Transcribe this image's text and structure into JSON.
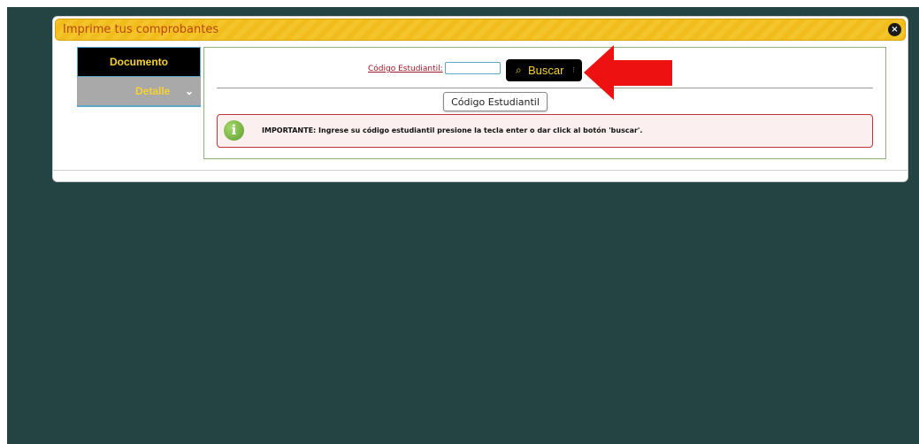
{
  "dialog": {
    "title": "Imprime tus comprobantes",
    "close_icon": "close-icon",
    "close_symbol": "×"
  },
  "sidebar": {
    "items": [
      {
        "label": "Documento",
        "active": true
      },
      {
        "label": "Detalle",
        "active": false,
        "chevron": "⌄"
      }
    ]
  },
  "search": {
    "label": "Código Estudiantil:",
    "input_value": "",
    "button_icon": "⌕",
    "button_label": "Buscar",
    "button_grip": "⁝",
    "tooltip": "Código Estudiantil"
  },
  "alert": {
    "icon": "i",
    "text": "IMPORTANTE: Ingrese su código estudiantil presione la tecla enter o dar click al botón 'buscar'."
  },
  "colors": {
    "background": "#244444",
    "title_bar": "#f4c52a",
    "accent_yellow": "#f6d033",
    "arrow": "#ee1111",
    "alert_border": "#c2343b",
    "content_border": "#8ab37a"
  }
}
